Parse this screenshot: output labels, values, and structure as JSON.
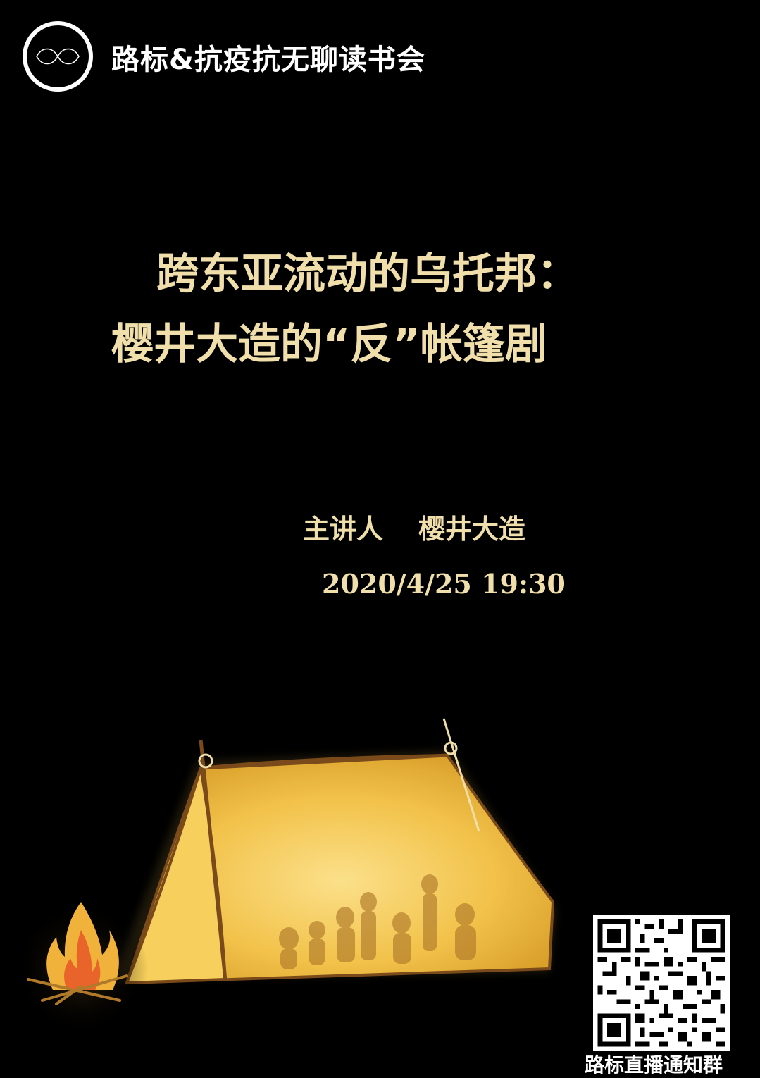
{
  "header": {
    "org_name": "路标&抗疫抗无聊读书会",
    "logo_icon": "infinity-circle-logo"
  },
  "title": {
    "line1": "跨东亚流动的乌托邦：",
    "line2": "樱井大造的“反”帐篷剧"
  },
  "speaker": {
    "label": "主讲人",
    "name": "樱井大造"
  },
  "event": {
    "datetime": "2020/4/25 19:30"
  },
  "qr": {
    "label": "路标直播通知群",
    "icon": "qr-code"
  },
  "colors": {
    "background": "#000000",
    "title": "#f0dfab",
    "tent": "#f2c24a",
    "fire": "#e8642a"
  }
}
